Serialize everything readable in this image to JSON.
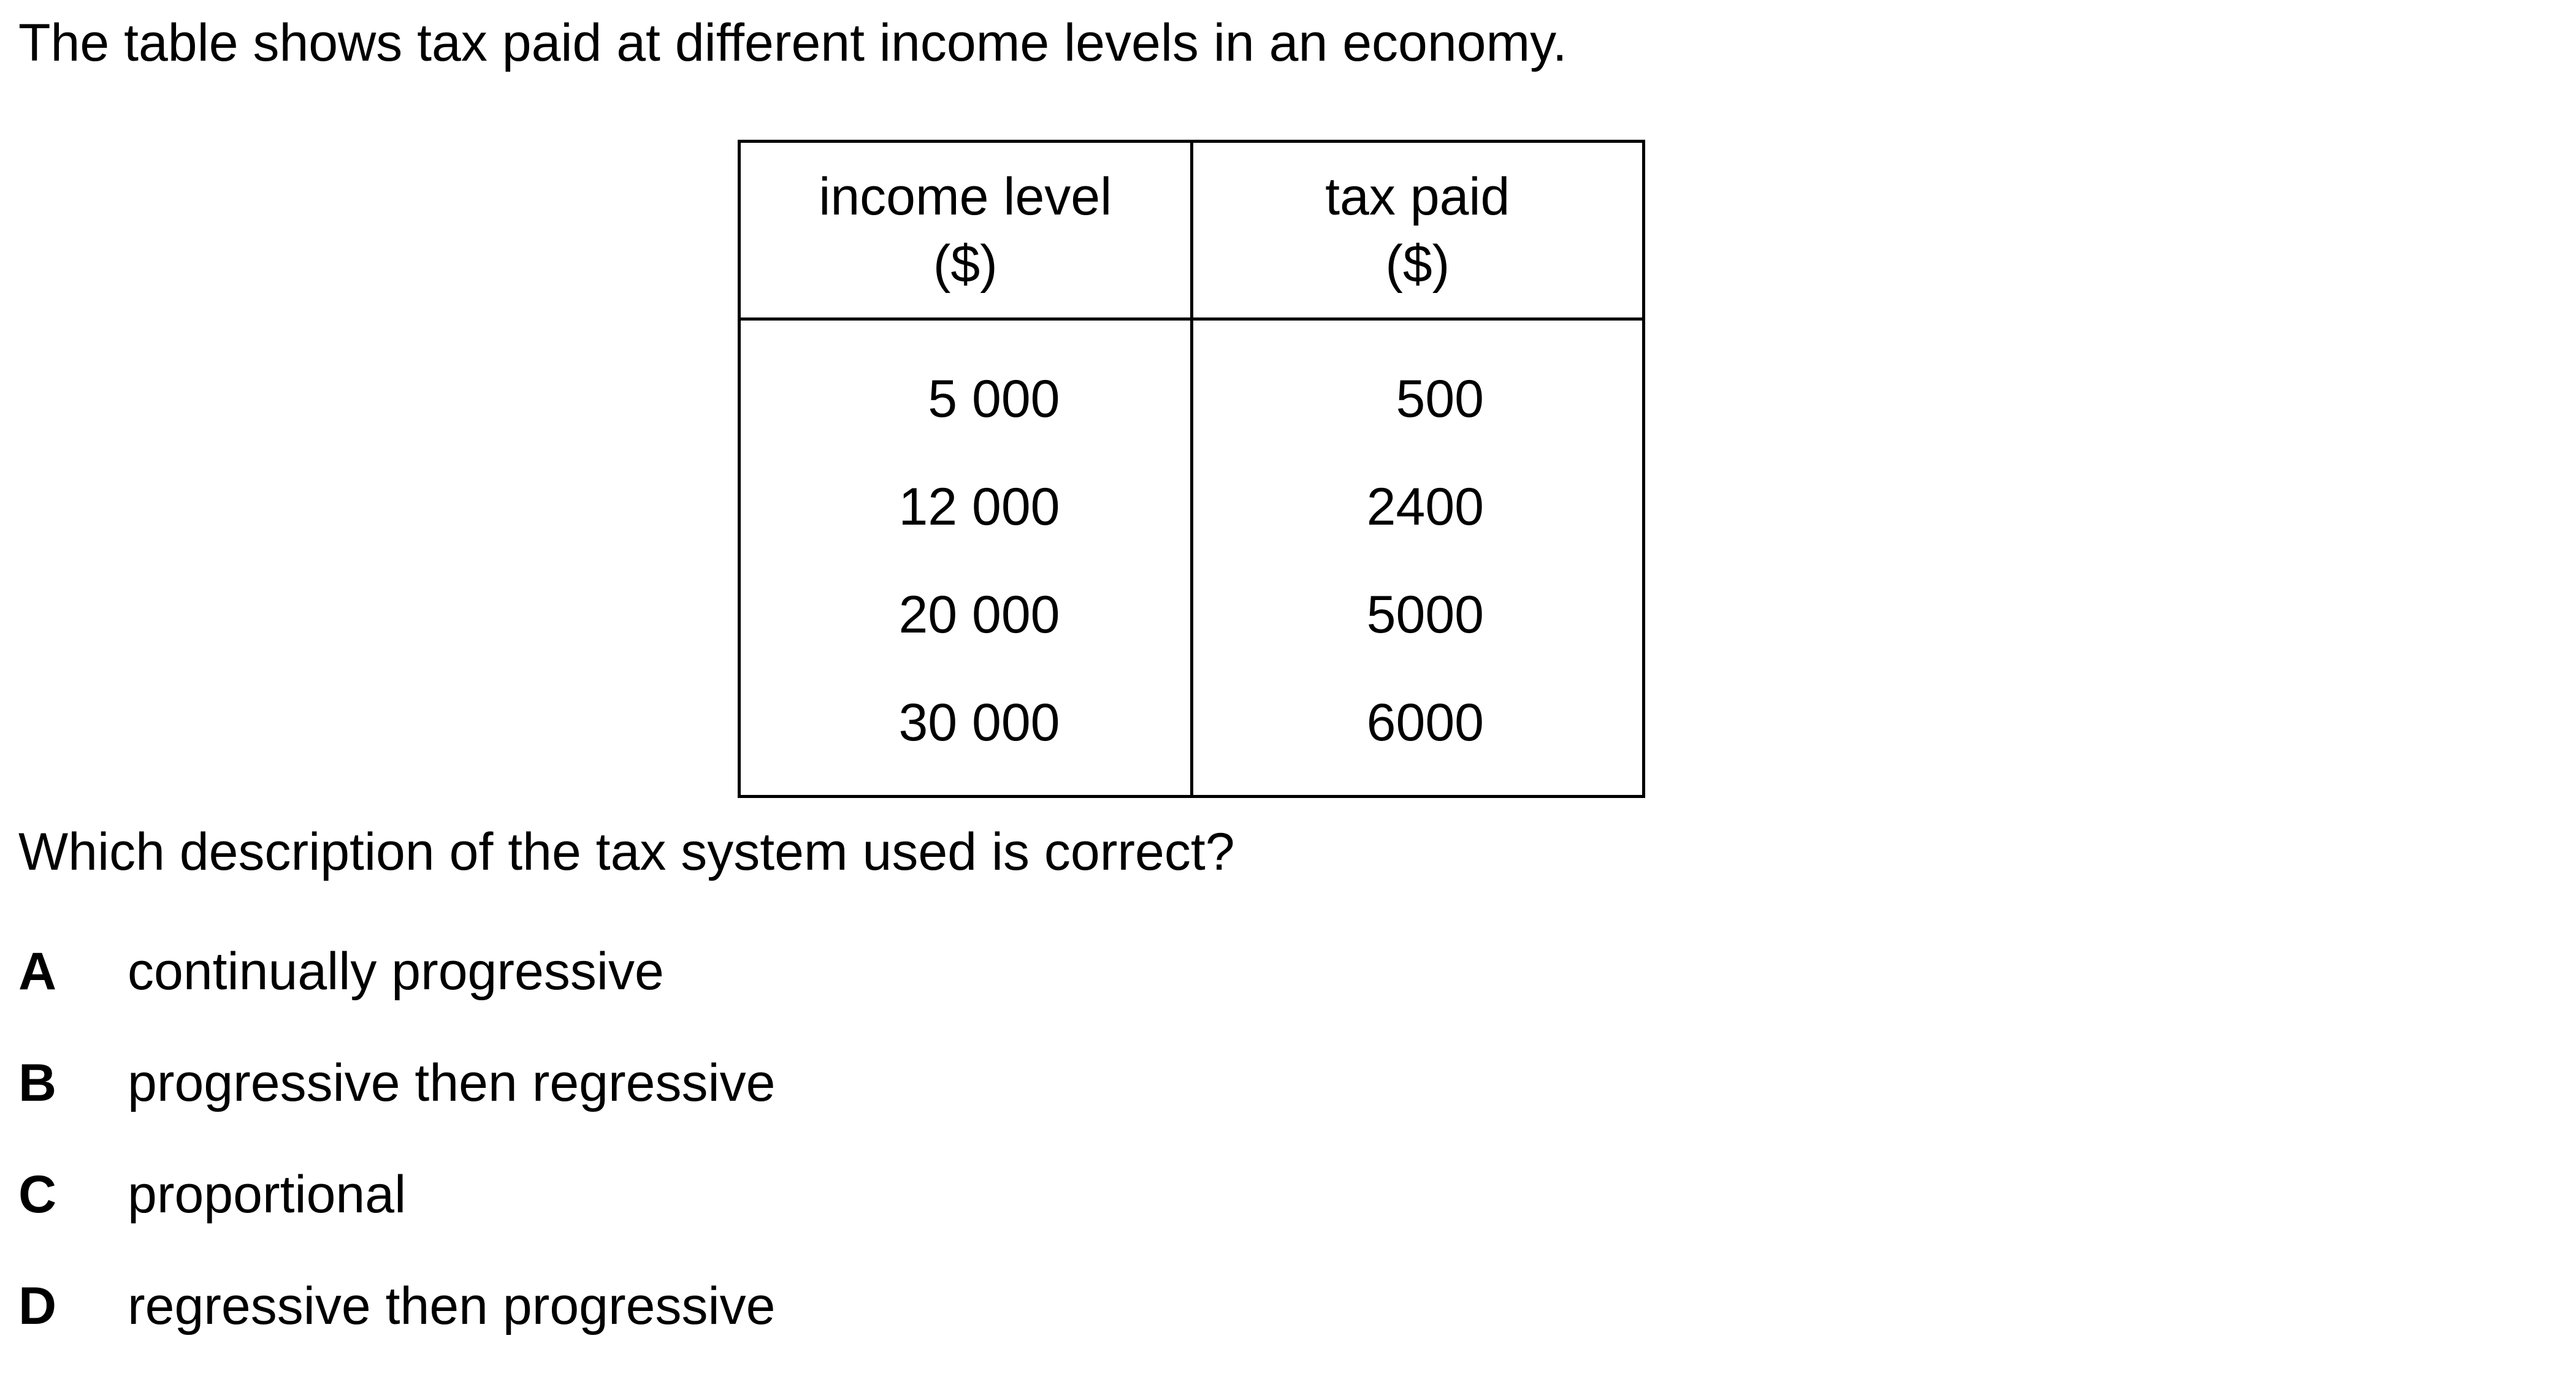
{
  "intro": "The table shows tax paid at different income levels in an economy.",
  "table": {
    "headers": [
      {
        "line1": "income level",
        "line2": "($)"
      },
      {
        "line1": "tax paid",
        "line2": "($)"
      }
    ],
    "rows": [
      {
        "income": "5 000",
        "tax": "500"
      },
      {
        "income": "12 000",
        "tax": "2400"
      },
      {
        "income": "20 000",
        "tax": "5000"
      },
      {
        "income": "30 000",
        "tax": "6000"
      }
    ]
  },
  "question": "Which description of the tax system used is correct?",
  "options": [
    {
      "letter": "A",
      "text": "continually progressive"
    },
    {
      "letter": "B",
      "text": "progressive then regressive"
    },
    {
      "letter": "C",
      "text": "proportional"
    },
    {
      "letter": "D",
      "text": "regressive then progressive"
    }
  ]
}
